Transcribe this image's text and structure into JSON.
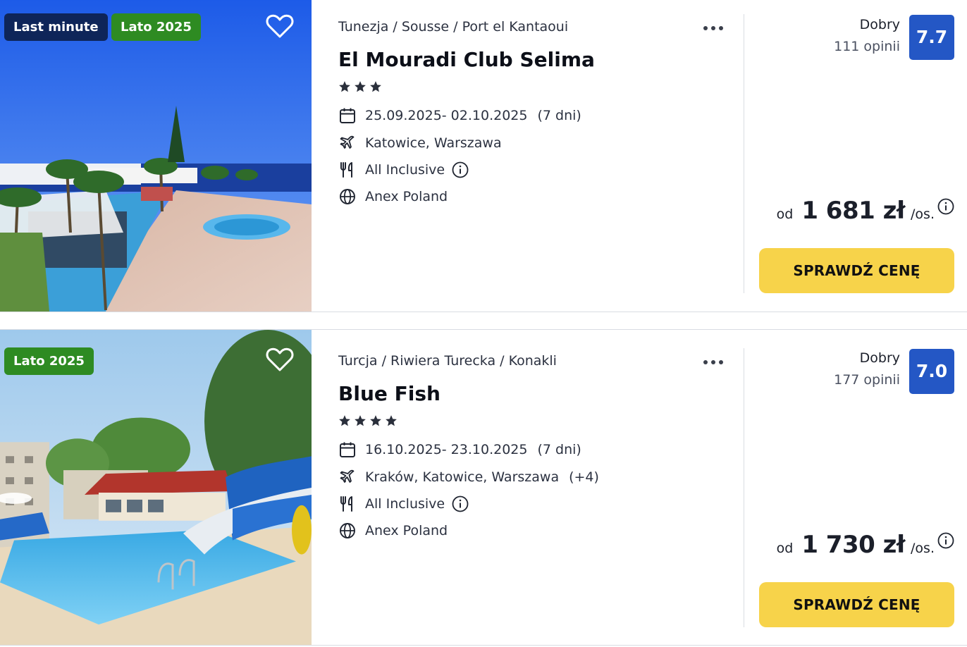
{
  "offers": [
    {
      "badges": [
        "Last minute",
        "Lato 2025"
      ],
      "breadcrumb": "Tunezja / Sousse / Port el Kantaoui",
      "title": "El Mouradi Club Selima",
      "stars": 3,
      "dates": "25.09.2025- 02.10.2025",
      "duration": "(7 dni)",
      "airports": "Katowice, Warszawa",
      "airports_extra": "",
      "board": "All Inclusive",
      "operator": "Anex Poland",
      "rating_label": "Dobry",
      "rating_count": "111 opinii",
      "score": "7.7",
      "price_prefix": "od",
      "price": "1 681 zł",
      "price_suffix": "/os.",
      "cta": "SPRAWDŹ CENĘ"
    },
    {
      "badges": [
        "Lato 2025"
      ],
      "breadcrumb": "Turcja / Riwiera Turecka / Konakli",
      "title": "Blue Fish",
      "stars": 4,
      "dates": "16.10.2025- 23.10.2025",
      "duration": "(7 dni)",
      "airports": "Kraków, Katowice, Warszawa",
      "airports_extra": "(+4)",
      "board": "All Inclusive",
      "operator": "Anex Poland",
      "rating_label": "Dobry",
      "rating_count": "177 opinii",
      "score": "7.0",
      "price_prefix": "od",
      "price": "1 730 zł",
      "price_suffix": "/os.",
      "cta": "SPRAWDŹ CENĘ"
    }
  ],
  "icons": {
    "favorite": "heart-icon",
    "more": "more-dots-icon",
    "dates": "calendar-icon",
    "airports": "plane-icon",
    "board": "fork-knife-icon",
    "operator": "globe-icon",
    "info": "info-icon",
    "stars": "star-icon"
  },
  "colors": {
    "badge_last_minute": "#0e2559",
    "badge_season": "#2e8b22",
    "score_bg": "#2457c5",
    "cta_bg": "#f7d34a"
  }
}
